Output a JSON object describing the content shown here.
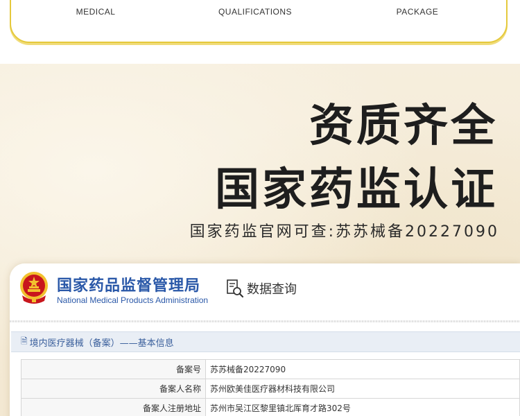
{
  "features": [
    {
      "label_en": "MEDICAL"
    },
    {
      "label_en": "QUALIFICATIONS"
    },
    {
      "label_en": "PACKAGE"
    }
  ],
  "headline": {
    "line1": "资质齐全",
    "line2": "国家药监认证",
    "subline": "国家药监官网可查:苏苏械备20227090"
  },
  "nmpa": {
    "agency_cn": "国家药品监督管理局",
    "agency_en": "National Medical Products Administration",
    "data_query_label": "数据查询",
    "breadcrumb": "境内医疗器械（备案）——基本信息",
    "rows": [
      {
        "key": "备案号",
        "value": "苏苏械备20227090"
      },
      {
        "key": "备案人名称",
        "value": "苏州欧美佳医疗器材科技有限公司"
      },
      {
        "key": "备案人注册地址",
        "value": "苏州市吴江区黎里镇北厍育才路302号"
      }
    ]
  },
  "colors": {
    "card_border": "#e5c93c",
    "agency_blue": "#2a58a8",
    "emblem_red": "#c8161d",
    "emblem_gold": "#f2c12e"
  },
  "icons": {
    "emblem": "national-emblem-icon",
    "data_query": "document-search-icon",
    "breadcrumb": "document-icon"
  }
}
